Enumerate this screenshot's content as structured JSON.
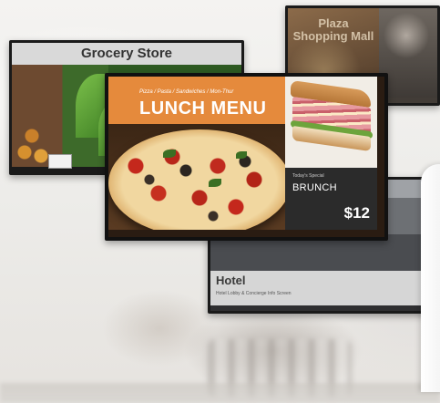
{
  "screens": {
    "mall": {
      "title_line1": "Plaza",
      "title_line2": "Shopping Mall"
    },
    "grocery": {
      "title": "Grocery Store"
    },
    "lunch": {
      "subtitle": "Pizza / Pasta / Sandwiches / Mon-Thur",
      "headline": "LUNCH MENU",
      "brunch_small": "Today's Special",
      "brunch_label": "BRUNCH",
      "price": "$12"
    },
    "hotel": {
      "title": "Hotel",
      "subtitle": "Hotel Lobby & Concierge Info Screen"
    }
  },
  "colors": {
    "lunch_accent": "#e58a3c",
    "grocery_header": "#d9d9d9",
    "hotel_bar": "#d6d6d6",
    "brunch_panel": "#2b2b2b"
  }
}
